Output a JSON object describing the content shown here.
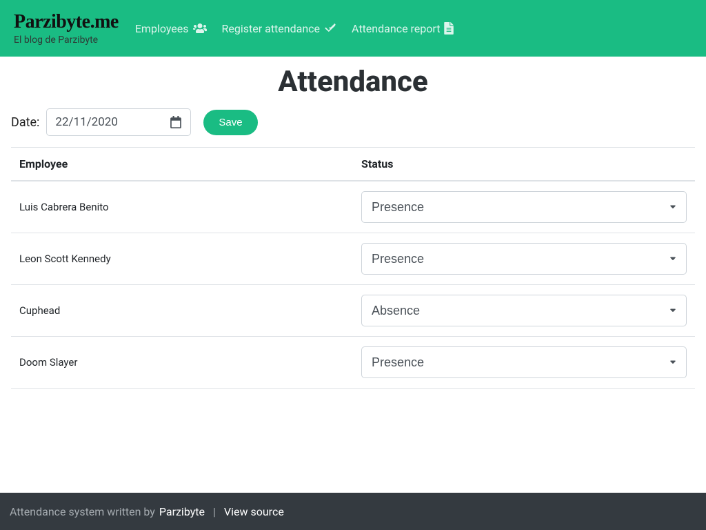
{
  "brand": {
    "title": "Parzibyte.me",
    "subtitle": "El blog de Parzibyte"
  },
  "nav": {
    "employees": "Employees",
    "register": "Register attendance",
    "report": "Attendance report"
  },
  "page": {
    "title": "Attendance",
    "date_label": "Date:",
    "date_value": "22/11/2020",
    "save_label": "Save"
  },
  "table": {
    "headers": {
      "employee": "Employee",
      "status": "Status"
    },
    "status_options": [
      "Presence",
      "Absence"
    ],
    "rows": [
      {
        "name": "Luis Cabrera Benito",
        "status": "Presence"
      },
      {
        "name": "Leon Scott Kennedy",
        "status": "Presence"
      },
      {
        "name": "Cuphead",
        "status": "Absence"
      },
      {
        "name": "Doom Slayer",
        "status": "Presence"
      }
    ]
  },
  "footer": {
    "prefix": "Attendance system written by ",
    "author": "Parzibyte",
    "sep": "|",
    "view_source": "View source"
  }
}
